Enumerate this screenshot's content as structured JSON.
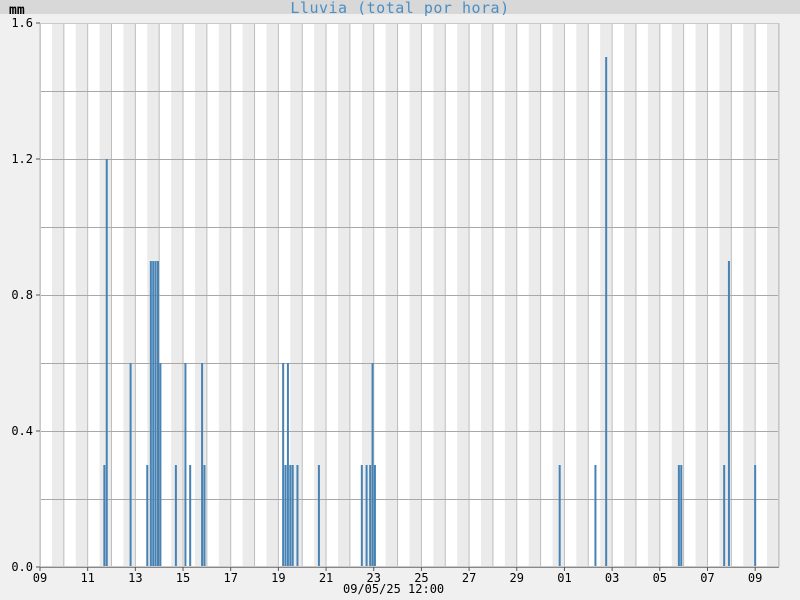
{
  "chart_data": {
    "type": "bar",
    "title": "Lluvia (total por hora)",
    "ylabel": "mm",
    "timestamp": "09/05/25 12:00",
    "ylim": [
      0,
      1.6
    ],
    "yticks": [
      "0.0",
      "0.4",
      "0.8",
      "1.2",
      "1.6"
    ],
    "xlim_days": [
      0,
      31
    ],
    "xticks": [
      {
        "day": 0,
        "label": "09"
      },
      {
        "day": 2,
        "label": "11"
      },
      {
        "day": 4,
        "label": "13"
      },
      {
        "day": 6,
        "label": "15"
      },
      {
        "day": 8,
        "label": "17"
      },
      {
        "day": 10,
        "label": "19"
      },
      {
        "day": 12,
        "label": "21"
      },
      {
        "day": 14,
        "label": "23"
      },
      {
        "day": 16,
        "label": "25"
      },
      {
        "day": 18,
        "label": "27"
      },
      {
        "day": 20,
        "label": "29"
      },
      {
        "day": 22,
        "label": "01"
      },
      {
        "day": 24,
        "label": "03"
      },
      {
        "day": 26,
        "label": "05"
      },
      {
        "day": 28,
        "label": "07"
      },
      {
        "day": 30,
        "label": "09"
      }
    ],
    "grid": true,
    "bar_color": "#4682b4",
    "values": [
      {
        "day": 2.7,
        "mm": 0.3
      },
      {
        "day": 2.8,
        "mm": 1.2
      },
      {
        "day": 3.8,
        "mm": 0.6
      },
      {
        "day": 4.5,
        "mm": 0.3
      },
      {
        "day": 4.65,
        "mm": 0.9
      },
      {
        "day": 4.75,
        "mm": 0.9
      },
      {
        "day": 4.85,
        "mm": 0.9
      },
      {
        "day": 4.95,
        "mm": 0.9
      },
      {
        "day": 5.05,
        "mm": 0.6
      },
      {
        "day": 5.7,
        "mm": 0.3
      },
      {
        "day": 6.1,
        "mm": 0.6
      },
      {
        "day": 6.3,
        "mm": 0.3
      },
      {
        "day": 6.8,
        "mm": 0.6
      },
      {
        "day": 6.9,
        "mm": 0.3
      },
      {
        "day": 10.2,
        "mm": 0.6
      },
      {
        "day": 10.3,
        "mm": 0.3
      },
      {
        "day": 10.4,
        "mm": 0.6
      },
      {
        "day": 10.5,
        "mm": 0.3
      },
      {
        "day": 10.6,
        "mm": 0.3
      },
      {
        "day": 10.8,
        "mm": 0.3
      },
      {
        "day": 11.7,
        "mm": 0.3
      },
      {
        "day": 13.5,
        "mm": 0.3
      },
      {
        "day": 13.7,
        "mm": 0.3
      },
      {
        "day": 13.85,
        "mm": 0.3
      },
      {
        "day": 13.95,
        "mm": 0.6
      },
      {
        "day": 14.05,
        "mm": 0.3
      },
      {
        "day": 21.8,
        "mm": 0.3
      },
      {
        "day": 23.3,
        "mm": 0.3
      },
      {
        "day": 23.75,
        "mm": 1.5
      },
      {
        "day": 26.8,
        "mm": 0.3
      },
      {
        "day": 26.9,
        "mm": 0.3
      },
      {
        "day": 28.7,
        "mm": 0.3
      },
      {
        "day": 28.9,
        "mm": 0.9
      },
      {
        "day": 30.0,
        "mm": 0.3
      }
    ]
  }
}
